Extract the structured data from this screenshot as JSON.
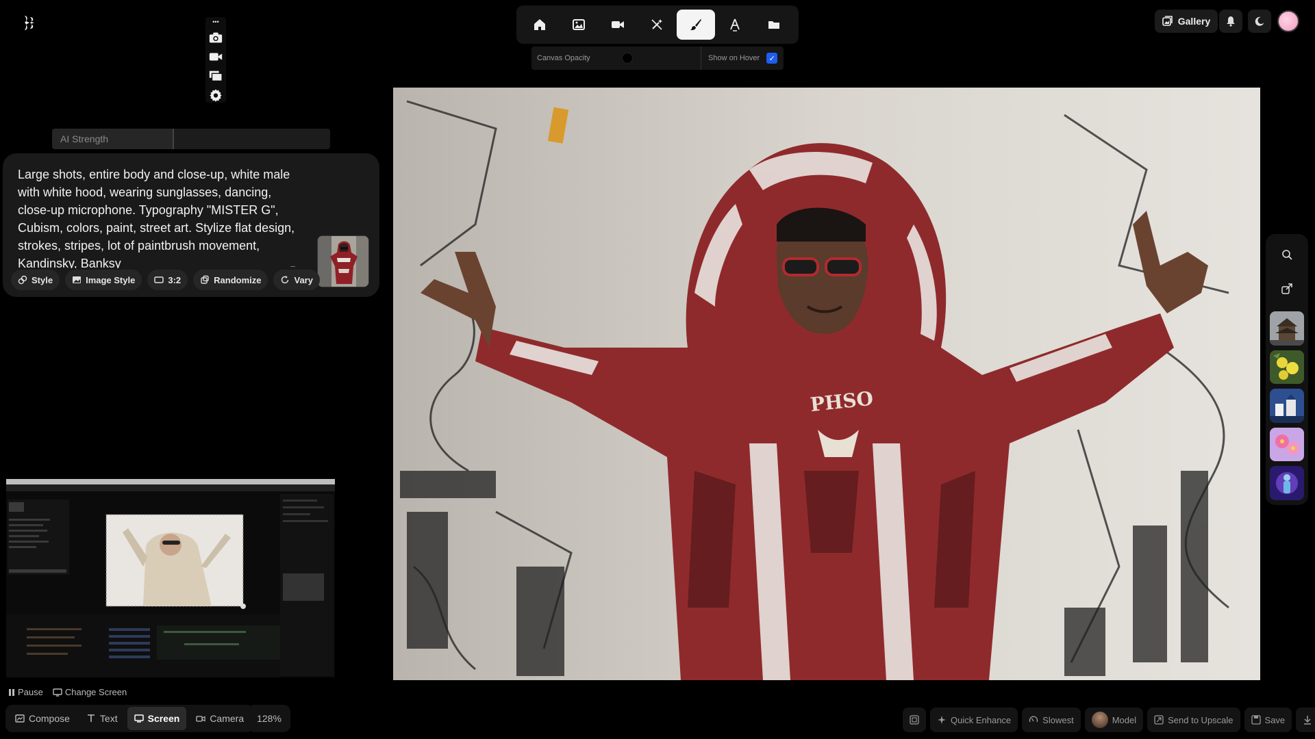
{
  "top_toolbar": {
    "tools": [
      {
        "name": "home-icon",
        "active": false
      },
      {
        "name": "image-icon",
        "active": false
      },
      {
        "name": "video-icon",
        "active": false
      },
      {
        "name": "magic-wand-off-icon",
        "active": false
      },
      {
        "name": "brush-icon",
        "active": true
      },
      {
        "name": "text-tool-icon",
        "active": false
      },
      {
        "name": "folder-icon",
        "active": false
      }
    ]
  },
  "canvas_opacity": {
    "label": "Canvas Opacity",
    "show_on_hover_label": "Show on Hover",
    "show_on_hover_checked": true
  },
  "mini_tools": {
    "dots": "•••"
  },
  "ai_strength": {
    "label": "AI Strength"
  },
  "prompt": {
    "text": "Large shots, entire body and close-up, white male with white hood, wearing sunglasses, dancing, close-up microphone. Typography \"MISTER G\", Cubism, colors, paint, street art. Stylize flat design, strokes, stripes, lot of paintbrush movement, Kandinsky, Banksy",
    "chips": {
      "style": "Style",
      "image_style": "Image Style",
      "ratio": "3:2",
      "randomize": "Randomize",
      "vary": "Vary"
    }
  },
  "header_right": {
    "gallery": "Gallery"
  },
  "screen_capture": {
    "pause": "Pause",
    "change_screen": "Change Screen"
  },
  "bottom_left": {
    "compose": "Compose",
    "text": "Text",
    "screen": "Screen",
    "camera": "Camera",
    "zoom": "128%"
  },
  "bottom_right": {
    "quick_enhance": "Quick Enhance",
    "speed": "Slowest",
    "model": "Model",
    "send_to_upscale": "Send to Upscale",
    "save": "Save"
  },
  "colors": {
    "accent": "#1f5cf0",
    "hoodie_red": "#9c2a2c",
    "background": "#000000"
  }
}
